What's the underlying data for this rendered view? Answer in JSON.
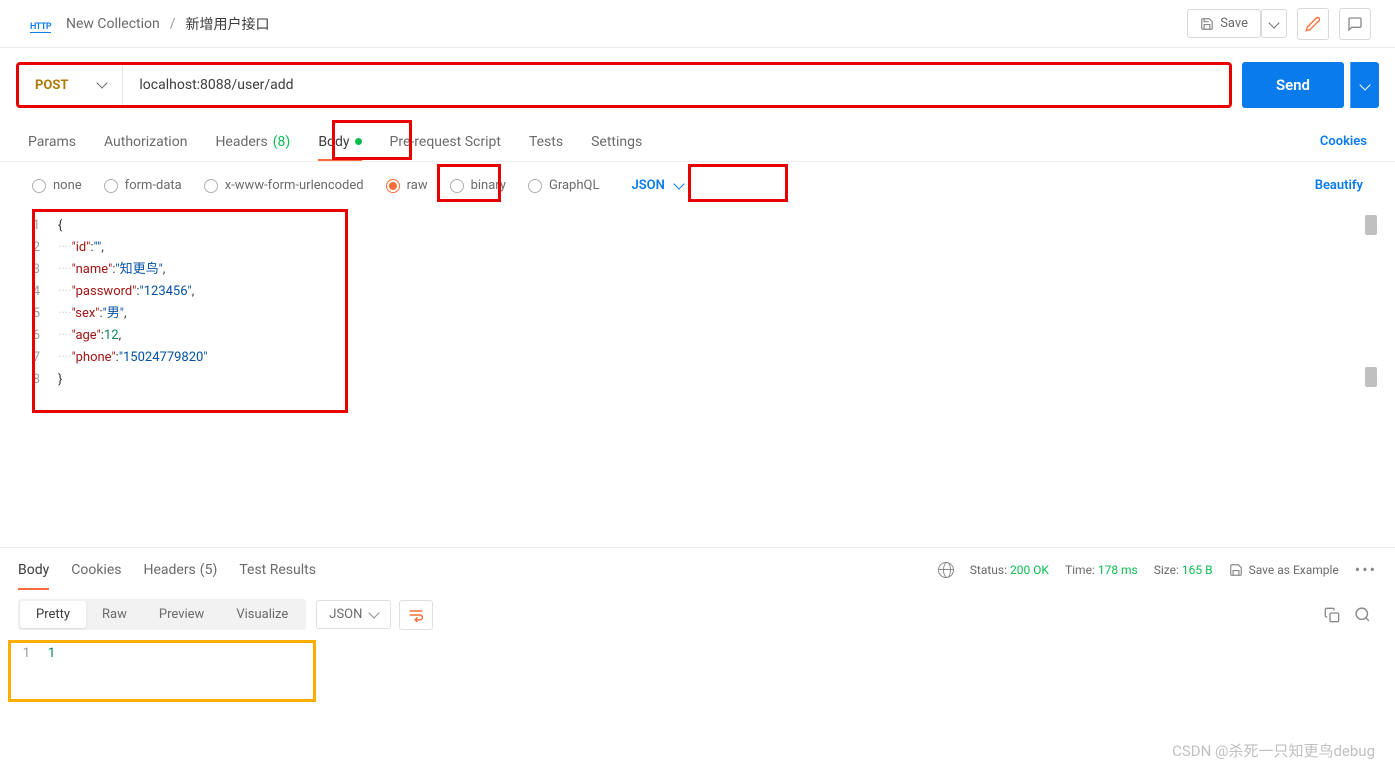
{
  "breadcrumb": {
    "collection": "New Collection",
    "request_name": "新增用户接口"
  },
  "header_actions": {
    "save": "Save"
  },
  "request": {
    "method": "POST",
    "url": "localhost:8088/user/add",
    "send": "Send"
  },
  "tabs": {
    "params": "Params",
    "authorization": "Authorization",
    "headers": "Headers",
    "headers_count": "(8)",
    "body": "Body",
    "prerequest": "Pre-request Script",
    "tests": "Tests",
    "settings": "Settings",
    "cookies": "Cookies"
  },
  "body_types": {
    "none": "none",
    "form_data": "form-data",
    "urlencoded": "x-www-form-urlencoded",
    "raw": "raw",
    "binary": "binary",
    "graphql": "GraphQL",
    "content_type": "JSON",
    "beautify": "Beautify"
  },
  "request_body": {
    "lines": [
      {
        "n": 1,
        "raw": "{"
      },
      {
        "n": 2,
        "key": "\"id\"",
        "val": "\"\"",
        "comma": ","
      },
      {
        "n": 3,
        "key": "\"name\"",
        "val": "\"知更鸟\"",
        "comma": ","
      },
      {
        "n": 4,
        "key": "\"password\"",
        "val": "\"123456\"",
        "comma": ","
      },
      {
        "n": 5,
        "key": "\"sex\"",
        "val": "\"男\"",
        "comma": ","
      },
      {
        "n": 6,
        "key": "\"age\"",
        "val": "12",
        "comma": ","
      },
      {
        "n": 7,
        "key": "\"phone\"",
        "val": "\"15024779820\"",
        "comma": ""
      },
      {
        "n": 8,
        "raw": "}"
      }
    ]
  },
  "response_tabs": {
    "body": "Body",
    "cookies": "Cookies",
    "headers": "Headers",
    "headers_count": "(5)",
    "test_results": "Test Results"
  },
  "response_meta": {
    "status_label": "Status:",
    "status_value": "200 OK",
    "time_label": "Time:",
    "time_value": "178 ms",
    "size_label": "Size:",
    "size_value": "165 B",
    "save_example": "Save as Example"
  },
  "response_views": {
    "pretty": "Pretty",
    "raw": "Raw",
    "preview": "Preview",
    "visualize": "Visualize",
    "format": "JSON"
  },
  "response_body": {
    "line_no": "1",
    "content": "1"
  },
  "watermark": "CSDN @杀死一只知更鸟debug"
}
